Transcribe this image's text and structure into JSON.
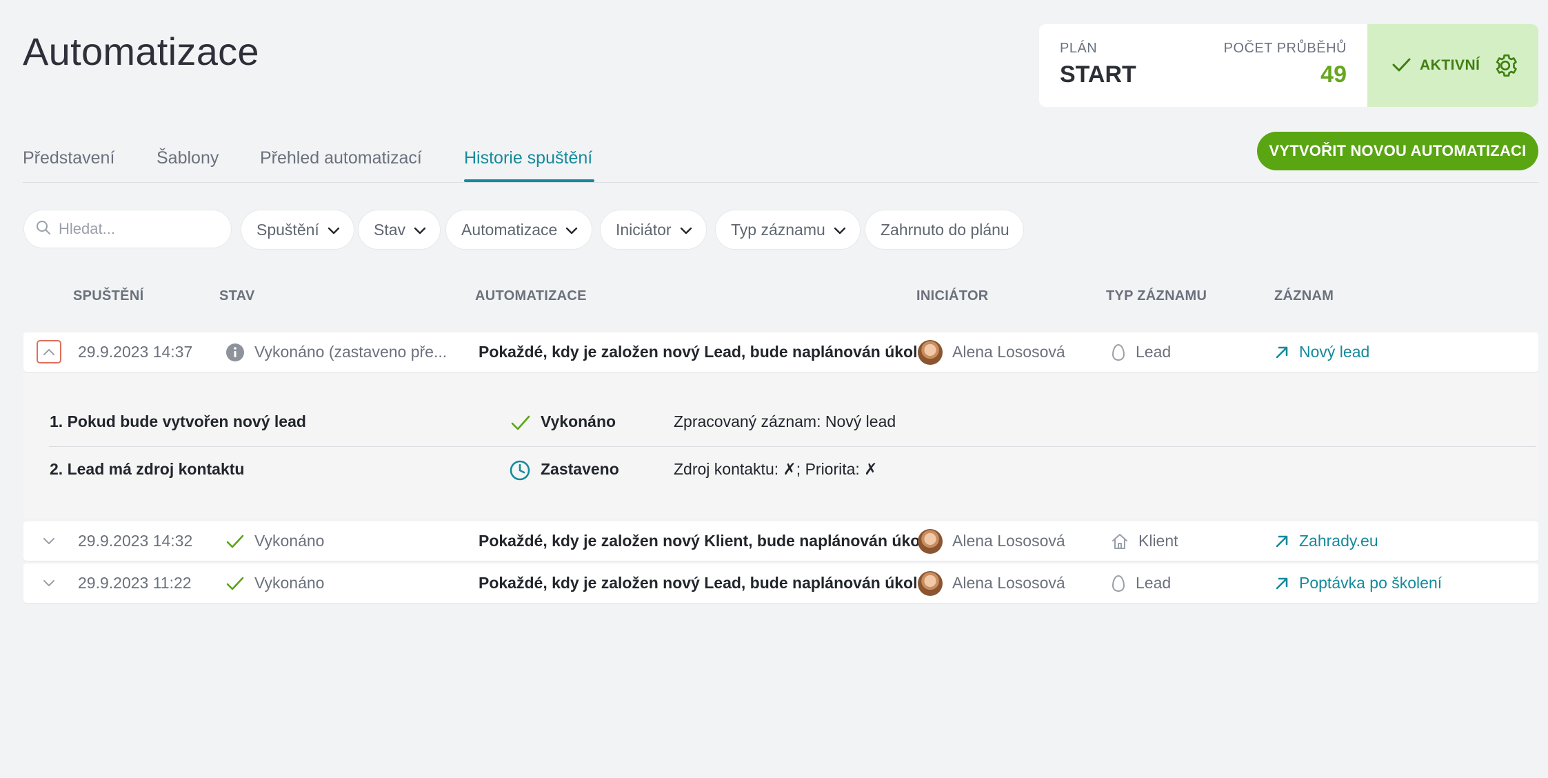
{
  "page": {
    "title": "Automatizace"
  },
  "plan": {
    "label": "PLÁN",
    "value": "START",
    "runs_label": "POČET PRŮBĚHŮ",
    "runs_value": "49",
    "status_label": "AKTIVNÍ"
  },
  "tabs": [
    {
      "label": "Představení"
    },
    {
      "label": "Šablony"
    },
    {
      "label": "Přehled automatizací"
    },
    {
      "label": "Historie spuštění"
    }
  ],
  "create_button": {
    "label": "VYTVOŘIT NOVOU AUTOMATIZACI"
  },
  "search": {
    "placeholder": "Hledat..."
  },
  "filters": [
    {
      "label": "Spuštění"
    },
    {
      "label": "Stav"
    },
    {
      "label": "Automatizace"
    },
    {
      "label": "Iniciátor"
    },
    {
      "label": "Typ záznamu"
    },
    {
      "label": "Zahrnuto do plánu"
    }
  ],
  "table": {
    "headers": {
      "run": "SPUŠTĚNÍ",
      "status": "STAV",
      "automation": "AUTOMATIZACE",
      "initiator": "INICIÁTOR",
      "record_type": "TYP ZÁZNAMU",
      "record": "ZÁZNAM"
    },
    "rows": [
      {
        "date": "29.9.2023 14:37",
        "status": "Vykonáno (zastaveno pře...",
        "automation": "Pokaždé, kdy je založen nový Lead, bude naplánován úkol",
        "initiator": "Alena Lososová",
        "record_type": "Lead",
        "record": "Nový lead"
      },
      {
        "date": "29.9.2023 14:32",
        "status": "Vykonáno",
        "automation": "Pokaždé, kdy je založen nový Klient, bude naplánován úkol",
        "initiator": "Alena Lososová",
        "record_type": "Klient",
        "record": "Zahrady.eu"
      },
      {
        "date": "29.9.2023 11:22",
        "status": "Vykonáno",
        "automation": "Pokaždé, kdy je založen nový Lead, bude naplánován úkol",
        "initiator": "Alena Lososová",
        "record_type": "Lead",
        "record": "Poptávka po školení"
      }
    ]
  },
  "detail": {
    "steps": [
      {
        "name": "1. Pokud bude vytvořen nový lead",
        "status": "Vykonáno",
        "info": "Zpracovaný záznam: Nový lead"
      },
      {
        "name": "2. Lead má zdroj kontaktu",
        "status": "Zastaveno",
        "info": "Zdroj kontaktu: ✗; Priorita: ✗"
      }
    ]
  },
  "colors": {
    "accent": "#148a9c",
    "primary_green": "#5aa512",
    "active_bg": "#d4efc4",
    "runs_green": "#66a61e",
    "expand_border": "#e26d5c"
  }
}
